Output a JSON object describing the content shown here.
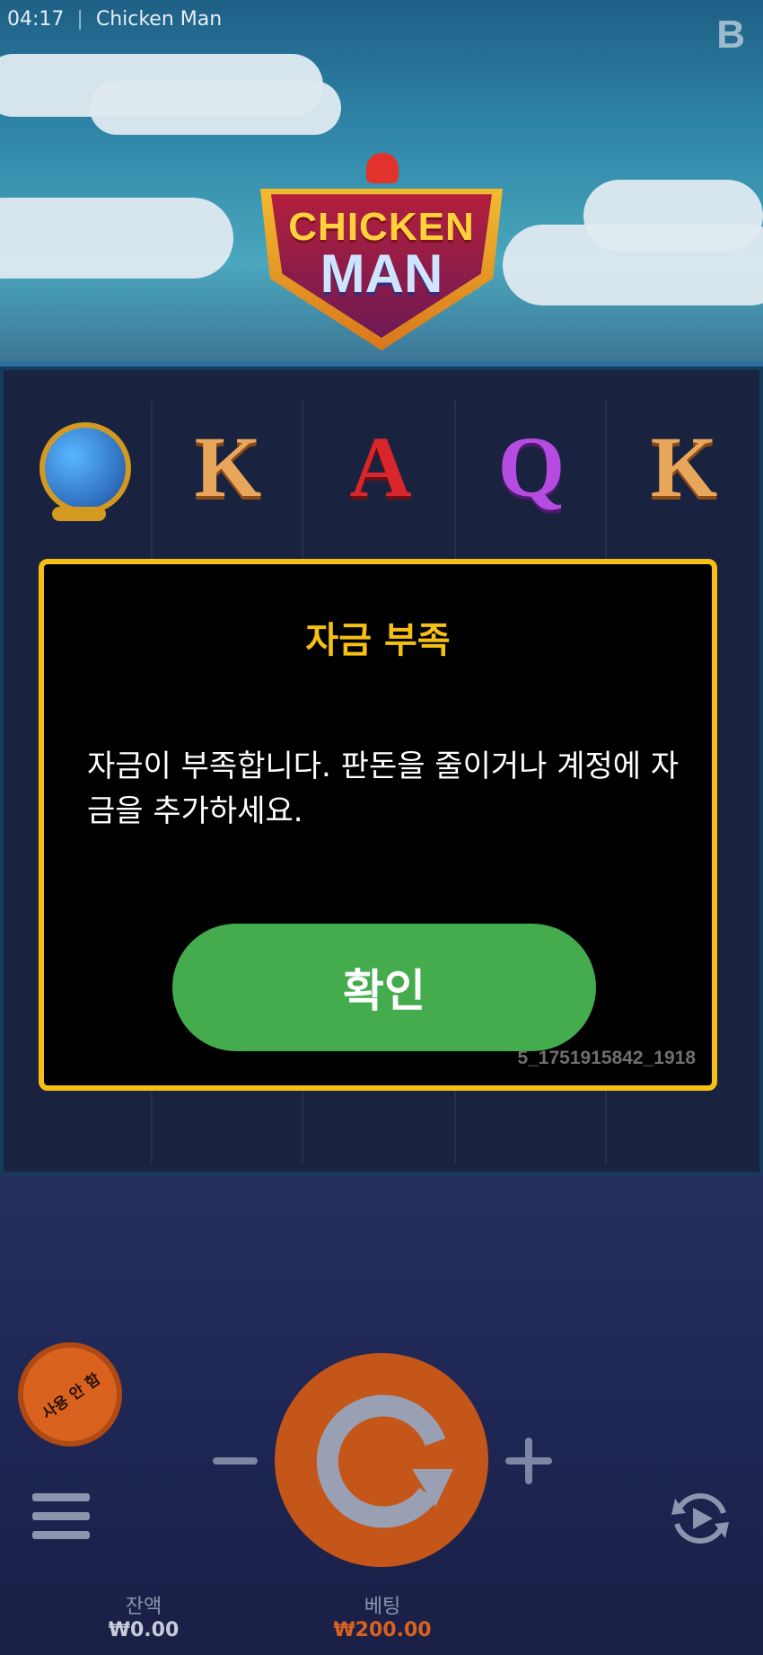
{
  "status_bar": {
    "time": "04:17",
    "app_title": "Chicken Man"
  },
  "header": {
    "brand_mark": "B"
  },
  "logo": {
    "line1": "CHICKEN",
    "line2": "MAN"
  },
  "reels": {
    "symbols_row1": [
      "globe",
      "K",
      "A",
      "Q",
      "K"
    ]
  },
  "dialog": {
    "title": "자금 부족",
    "message": "자금이 부족합니다. 판돈을 줄이거나 계정에 자금을 추가하세요.",
    "confirm_label": "확인",
    "code": "5_1751915842_1918",
    "border_color": "#f5c013",
    "button_color": "#44ac4d"
  },
  "controls": {
    "no_use_badge": "사용 안 함",
    "menu_icon": "hamburger-icon",
    "spin_icon": "spin-arrow-icon",
    "autoplay_icon": "autoplay-icon",
    "minus_icon": "minus-icon",
    "plus_icon": "plus-icon"
  },
  "footer": {
    "balance_label": "잔액",
    "balance_value": "₩0.00",
    "bet_label": "베팅",
    "bet_value": "₩200.00"
  }
}
